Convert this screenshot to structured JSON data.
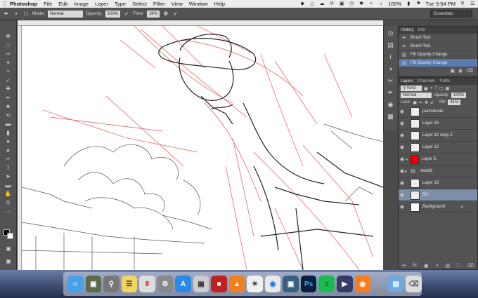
{
  "menubar": {
    "app_name": "Photoshop",
    "items": [
      "File",
      "Edit",
      "Image",
      "Layer",
      "Type",
      "Select",
      "Filter",
      "View",
      "Window",
      "Help"
    ],
    "battery": "100%",
    "clock": "Tue 9:54 PM"
  },
  "options": {
    "mode_label": "Mode:",
    "mode_value": "Normal",
    "opacity_label": "Opacity:",
    "opacity_value": "100%",
    "flow_label": "Flow:",
    "flow_value": "19%",
    "workspace": "Essentials"
  },
  "history": {
    "tabs": [
      "History",
      "Info"
    ],
    "items": [
      {
        "label": "Brush Tool",
        "selected": false
      },
      {
        "label": "Brush Tool",
        "selected": false
      },
      {
        "label": "Fill Opacity Change",
        "selected": false
      },
      {
        "label": "Fill Opacity Change",
        "selected": true
      }
    ]
  },
  "layers": {
    "tabs": [
      "Layers",
      "Channels",
      "Paths"
    ],
    "kind": "Kind",
    "blend": "Normal",
    "opacity_label": "Opacity:",
    "opacity_value": "100%",
    "lock_label": "Lock:",
    "fill_label": "Fill:",
    "fill_value": "41%",
    "items": [
      {
        "name": "pantsboots",
        "thumb": "checker",
        "selected": false
      },
      {
        "name": "Layer 15",
        "thumb": "checker",
        "selected": false
      },
      {
        "name": "Layer 12 copy 2",
        "thumb": "checker",
        "selected": false
      },
      {
        "name": "Layer 12",
        "thumb": "checker",
        "selected": false
      },
      {
        "name": "Layer 5",
        "thumb": "red",
        "selected": false
      },
      {
        "name": "sketch",
        "thumb": "folder",
        "selected": false
      },
      {
        "name": "Layer 13",
        "thumb": "checker",
        "selected": false
      },
      {
        "name": "BG",
        "thumb": "checker",
        "selected": true
      },
      {
        "name": "Background",
        "thumb": "white",
        "selected": false
      }
    ]
  },
  "colors": {
    "sketch_red": "#e05a5a",
    "selection_blue": "#5b7bb0",
    "layer_selected": "#7d8ea8"
  }
}
